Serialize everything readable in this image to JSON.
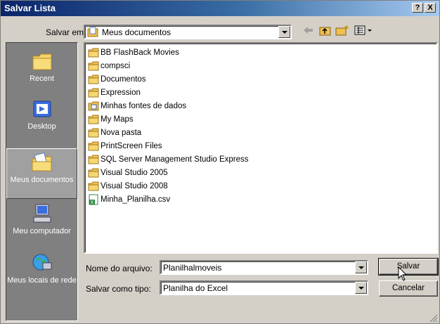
{
  "window": {
    "title": "Salvar Lista",
    "help_label": "?",
    "close_label": "X"
  },
  "toolbar": {
    "save_in_label": "Salvar em:",
    "save_in_value": "Meus documentos",
    "icons": [
      "back-arrow-icon",
      "up-folder-icon",
      "new-folder-icon",
      "views-menu-icon"
    ]
  },
  "places": [
    {
      "label": "Recent",
      "icon": "recent-folder-icon",
      "active": false
    },
    {
      "label": "Desktop",
      "icon": "desktop-icon",
      "active": false
    },
    {
      "label": "Meus documentos",
      "icon": "my-documents-icon",
      "active": true
    },
    {
      "label": "Meu computador",
      "icon": "my-computer-icon",
      "active": false
    },
    {
      "label": "Meus locais de rede",
      "icon": "network-places-icon",
      "active": false
    }
  ],
  "files": [
    {
      "name": "BB FlashBack Movies",
      "type": "folder"
    },
    {
      "name": "compsci",
      "type": "folder"
    },
    {
      "name": "Documentos",
      "type": "folder"
    },
    {
      "name": "Expression",
      "type": "folder"
    },
    {
      "name": "Minhas fontes de dados",
      "type": "datasource-folder"
    },
    {
      "name": "My Maps",
      "type": "folder"
    },
    {
      "name": "Nova pasta",
      "type": "folder"
    },
    {
      "name": "PrintScreen Files",
      "type": "folder"
    },
    {
      "name": "SQL Server Management Studio Express",
      "type": "folder"
    },
    {
      "name": "Visual Studio 2005",
      "type": "folder"
    },
    {
      "name": "Visual Studio 2008",
      "type": "folder"
    },
    {
      "name": "Minha_Planilha.csv",
      "type": "excel-file"
    }
  ],
  "form": {
    "filename_label": "Nome do arquivo:",
    "filename_value": "Planilhalmoveis",
    "filetype_label": "Salvar como tipo:",
    "filetype_value": "Planilha do Excel"
  },
  "buttons": {
    "save_label": "Salvar",
    "cancel_label": "Cancelar"
  },
  "colors": {
    "title_bar_start": "#0a246a",
    "title_bar_end": "#a6caf0",
    "face": "#d4d0c8",
    "places_bar": "#808080",
    "folder": "#f0c050"
  }
}
